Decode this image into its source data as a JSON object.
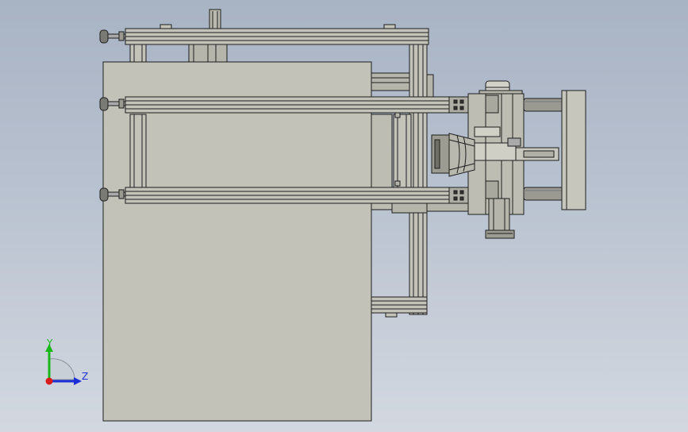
{
  "triad": {
    "y_label": "Y",
    "z_label": "Z",
    "y_color": "#18b818",
    "z_color": "#1b2fd8",
    "x_color": "#d81b1b"
  },
  "colors": {
    "background_top": "#a8b3c4",
    "background_bottom": "#d3d8e0",
    "part_fill": "#c3c3b9",
    "edge": "#1e1e1e"
  }
}
